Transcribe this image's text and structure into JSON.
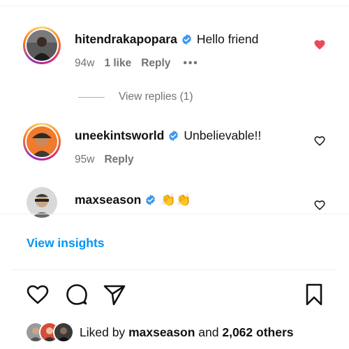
{
  "comments": [
    {
      "username": "hitendrakapopara",
      "text": "Hello friend",
      "time": "94w",
      "likes": "1 like",
      "reply_label": "Reply",
      "more": "•••",
      "liked": true
    },
    {
      "username": "uneekintsworld",
      "text": "Unbelievable!!",
      "time": "95w",
      "reply_label": "Reply",
      "liked": false
    },
    {
      "username": "maxseason",
      "text": "👏👏",
      "liked": false
    }
  ],
  "view_replies": "View replies (1)",
  "view_insights": "View insights",
  "likes_summary": {
    "prefix": "Liked by",
    "user": "maxseason",
    "joiner": "and",
    "others": "2,062 others"
  },
  "colors": {
    "link_blue": "#0095f6",
    "liked_red": "#ed4956",
    "verified_blue": "#3897f0",
    "muted_text": "#737373"
  },
  "icons": {
    "like": "heart-outline-icon",
    "comment": "speech-bubble-icon",
    "share": "paper-plane-icon",
    "save": "bookmark-icon"
  }
}
